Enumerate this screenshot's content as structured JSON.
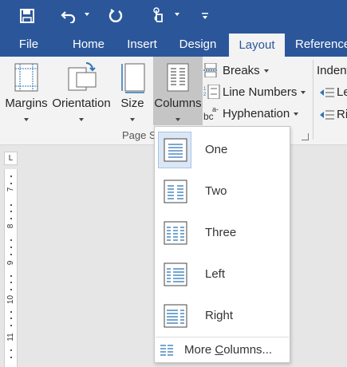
{
  "qat": {
    "save_icon": "save-icon",
    "undo_icon": "undo-icon",
    "redo_icon": "repeat-icon",
    "touch_icon": "touch-mode-icon",
    "customize_icon": "customize-qat-icon"
  },
  "tabs": [
    {
      "label": "File"
    },
    {
      "label": "Home"
    },
    {
      "label": "Insert"
    },
    {
      "label": "Design"
    },
    {
      "label": "Layout"
    },
    {
      "label": "Reference"
    }
  ],
  "ribbon": {
    "margins": "Margins",
    "orientation": "Orientation",
    "size": "Size",
    "columns": "Columns",
    "breaks": "Breaks",
    "line_numbers": "Line Numbers",
    "hyphenation": "Hyphenation",
    "group_label": "Page S",
    "indent": "Indent",
    "indent_left": "Le",
    "indent_right": "Ri"
  },
  "ruler": {
    "corner_glyph": "L",
    "numbers": [
      "7",
      "8",
      "9",
      "10",
      "11"
    ]
  },
  "columns_menu": {
    "items": [
      {
        "label": "One"
      },
      {
        "label": "Two"
      },
      {
        "label": "Three"
      },
      {
        "label": "Left"
      },
      {
        "label": "Right"
      }
    ],
    "more_prefix": "More ",
    "more_underlined": "C",
    "more_suffix": "olumns..."
  },
  "colors": {
    "brand": "#2b579a",
    "ribbon_bg": "#f3f3f3",
    "accent_blue": "#2e75b6",
    "hover_bg": "#dbe7f5"
  }
}
